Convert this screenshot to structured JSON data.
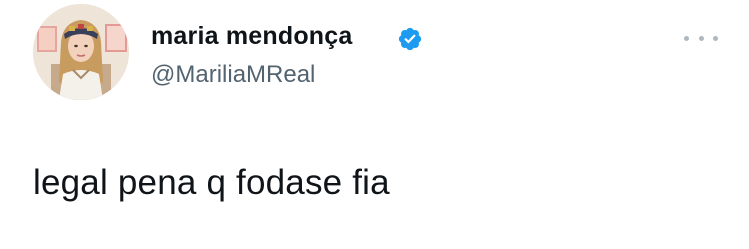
{
  "tweet": {
    "author": {
      "display_name": "maria mendonça",
      "handle": "@MariliaMReal",
      "verified": true,
      "verified_icon": "verified-badge-icon",
      "avatar_icon": "profile-photo"
    },
    "more_icon": "more-options-icon",
    "text": "legal pena q fodase fia"
  },
  "colors": {
    "name_text": "#0f1419",
    "handle_text": "#536471",
    "verified_badge": "#1d9bf0",
    "more_dots": "#b0b8be",
    "background": "#ffffff"
  }
}
